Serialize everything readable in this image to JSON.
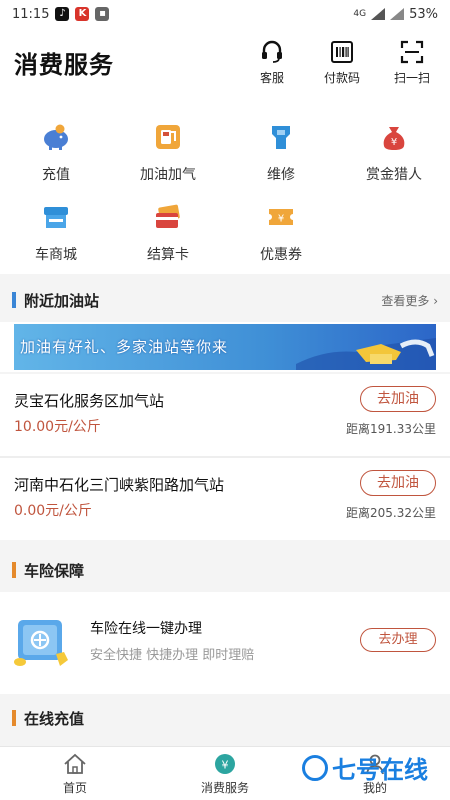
{
  "status_bar": {
    "time": "11:15",
    "signal_label": "4G",
    "battery": "53%"
  },
  "header": {
    "title": "消费服务",
    "actions": [
      {
        "label": "客服",
        "icon": "headset-icon"
      },
      {
        "label": "付款码",
        "icon": "barcode-icon"
      },
      {
        "label": "扫一扫",
        "icon": "scan-icon"
      }
    ]
  },
  "services": [
    {
      "label": "充值",
      "icon": "piggy-bank-icon"
    },
    {
      "label": "加油加气",
      "icon": "fuel-pump-icon"
    },
    {
      "label": "维修",
      "icon": "repair-icon"
    },
    {
      "label": "赏金猎人",
      "icon": "money-bag-icon"
    },
    {
      "label": "车商城",
      "icon": "store-icon"
    },
    {
      "label": "结算卡",
      "icon": "card-icon"
    },
    {
      "label": "优惠券",
      "icon": "coupon-icon"
    }
  ],
  "nearby": {
    "title": "附近加油站",
    "more": "查看更多 ›",
    "banner_text": "加油有好礼、多家油站等你来",
    "stations": [
      {
        "name": "灵宝石化服务区加气站",
        "price": "10.00元/公斤",
        "action": "去加油",
        "distance": "距离191.33公里"
      },
      {
        "name": "河南中石化三门峡紫阳路加气站",
        "price": "0.00元/公斤",
        "action": "去加油",
        "distance": "距离205.32公里"
      }
    ]
  },
  "insurance": {
    "title": "车险保障",
    "headline": "车险在线一键办理",
    "subline": "安全快捷  快捷办理  即时理赔",
    "action": "去办理"
  },
  "recharge": {
    "title": "在线充值"
  },
  "tabs": [
    {
      "label": "首页",
      "icon": "home-icon"
    },
    {
      "label": "消费服务",
      "icon": "yuan-icon"
    },
    {
      "label": "我的",
      "icon": "user-icon"
    }
  ],
  "watermark": "七号在线",
  "colors": {
    "accent": "#c0553e",
    "section_bar_blue": "#3a86d6",
    "section_bar_orange": "#e58a2c",
    "tab_active": "#2ca5a0"
  }
}
